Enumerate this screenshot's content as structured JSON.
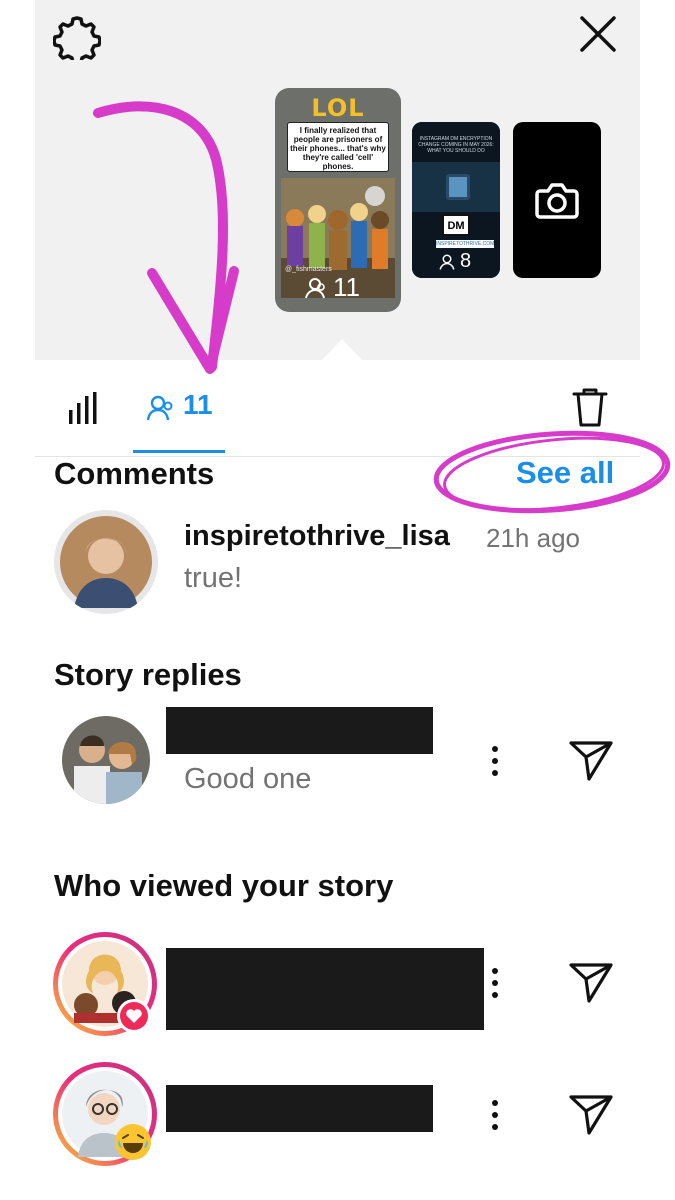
{
  "header": {
    "settings_icon": "gear-icon",
    "close_icon": "close-icon"
  },
  "stories": [
    {
      "banner": "LOL",
      "caption": "I finally realized that people are prisoners of their phones... that's why they're called 'cell' phones.",
      "handle": "@_fishmasters",
      "viewers": "11"
    },
    {
      "caption": "INSTAGRAM DM ENCRYPTION CHANGE COMING IN MAY 2026: WHAT YOU SHOULD DO",
      "badge": "DM",
      "link": "INSPIRETOTHRIVE.COM",
      "viewers": "8"
    },
    {
      "icon": "camera-icon"
    }
  ],
  "tabs": {
    "insights_icon": "bar-chart-icon",
    "viewers_count": "11",
    "delete_icon": "trash-icon"
  },
  "comments": {
    "title": "Comments",
    "see_all": "See all",
    "items": [
      {
        "username": "inspiretothrive_lisa",
        "time": "21h ago",
        "text": "true!"
      }
    ]
  },
  "story_replies": {
    "title": "Story replies",
    "items": [
      {
        "text": "Good one"
      }
    ]
  },
  "viewers": {
    "title": "Who viewed your story"
  },
  "colors": {
    "accent": "#1b8ee8",
    "annotation": "#d63cc9",
    "story_ring_start": "#f9ce34",
    "story_ring_end": "#c13584"
  }
}
